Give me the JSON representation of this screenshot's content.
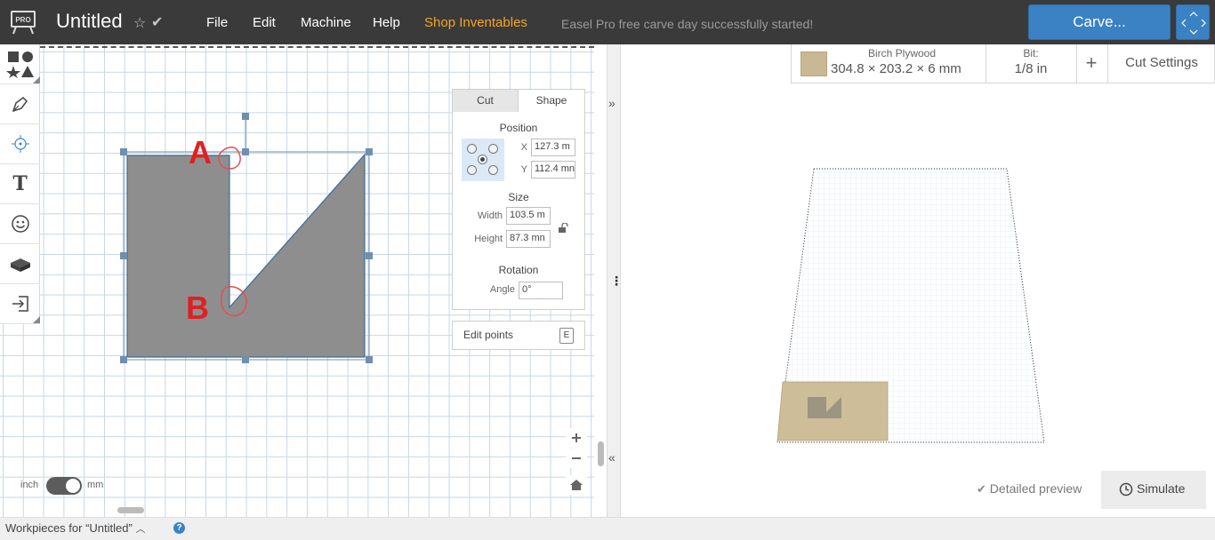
{
  "app": {
    "title": "Untitled",
    "logo_badge": "PRO",
    "status_message": "Easel Pro free carve day successfully started!"
  },
  "menu": {
    "file": "File",
    "edit": "Edit",
    "machine": "Machine",
    "help": "Help",
    "shop": "Shop Inventables"
  },
  "carve_button": "Carve...",
  "colors": {
    "topbar": "#3a3a3a",
    "accent": "#3b82c4",
    "shop": "#f5a623",
    "shape_fill": "#8e8e8e",
    "annotation": "#e02020"
  },
  "tools": [
    "shapes-icon",
    "pen-icon",
    "target-icon",
    "text-icon",
    "emoji-icon",
    "apps-icon",
    "import-icon"
  ],
  "tools_text_glyph": "T",
  "annotations": {
    "a": "A",
    "b": "B"
  },
  "shape_panel": {
    "tabs": {
      "cut": "Cut",
      "shape": "Shape"
    },
    "position_title": "Position",
    "x_label": "X",
    "x_value": "127.3 m",
    "y_label": "Y",
    "y_value": "112.4 mn",
    "size_title": "Size",
    "width_label": "Width",
    "width_value": "103.5 m",
    "height_label": "Height",
    "height_value": "87.3 mn",
    "rotation_title": "Rotation",
    "angle_label": "Angle",
    "angle_value": "0°",
    "edit_points": "Edit points",
    "edit_points_key": "E"
  },
  "units": {
    "left": "inch",
    "right": "mm",
    "selected": "mm"
  },
  "material": {
    "name": "Birch Plywood",
    "dims": "304.8 × 203.2 × 6 mm",
    "bit_label": "Bit:",
    "bit_value": "1/8 in",
    "cut_settings": "Cut Settings"
  },
  "preview": {
    "detailed": "Detailed preview",
    "simulate": "Simulate"
  },
  "bottom": {
    "workpieces": "Workpieces for “Untitled”",
    "help": "?"
  }
}
